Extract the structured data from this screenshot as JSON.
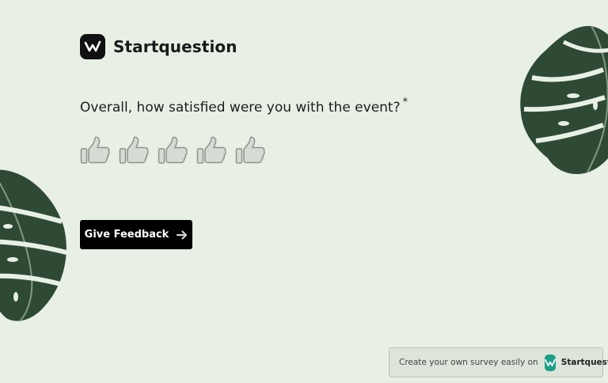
{
  "brand": {
    "name": "Startquestion",
    "logo_icon": "w-logo-icon"
  },
  "question": {
    "text": "Overall, how satisfied were you with the event?",
    "required_mark": "*"
  },
  "rating": {
    "icon": "thumbs-up-icon",
    "count": 5,
    "selected": 0
  },
  "submit": {
    "label": "Give Feedback",
    "icon": "arrow-right-icon"
  },
  "footer": {
    "promo_text": "Create your own survey easily on",
    "brand_name": "Startquestion",
    "brand_icon": "w-logo-icon",
    "brand_color": "#1d9e86"
  },
  "colors": {
    "background": "#e8f0e5",
    "button": "#000000",
    "leaf": "#2f4a34"
  }
}
